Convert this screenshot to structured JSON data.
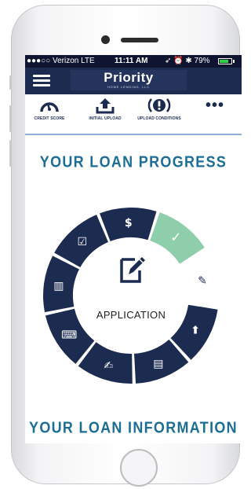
{
  "status_bar": {
    "carrier": "●●●○○ Verizon  LTE",
    "time": "11:11 AM",
    "indicators": "➶ ⏰ ✱ 79%",
    "battery_level": 0.79
  },
  "header": {
    "brand_name": "Priority",
    "brand_tagline": "HOME LENDING, LLC",
    "menu_icon": "hamburger-icon"
  },
  "toolbar": {
    "items": [
      {
        "label": "CREDIT SCORE",
        "icon": "gauge-icon"
      },
      {
        "label": "INITIAL UPLOAD",
        "icon": "upload-icon"
      },
      {
        "label": "UPLOAD CONDITIONS",
        "icon": "alert-icon"
      },
      {
        "label": "",
        "icon": "more-icon",
        "text": "•••"
      }
    ]
  },
  "progress": {
    "title": "YOUR LOAN PROGRESS",
    "current_step": "APPLICATION",
    "current_icon": "edit-document-icon",
    "segments": [
      {
        "icon": "dollar-icon",
        "glyph": "$",
        "state": "pending"
      },
      {
        "icon": "check-icon",
        "glyph": "✓",
        "state": "complete"
      },
      {
        "icon": "edit-icon",
        "glyph": "✎",
        "state": "current"
      },
      {
        "icon": "upload-arrow-icon",
        "glyph": "⬆",
        "state": "pending"
      },
      {
        "icon": "document-icon",
        "glyph": "▤",
        "state": "pending"
      },
      {
        "icon": "signed-document-icon",
        "glyph": "✍",
        "state": "pending"
      },
      {
        "icon": "keyboard-icon",
        "glyph": "⌨",
        "state": "pending"
      },
      {
        "icon": "notebook-icon",
        "glyph": "▥",
        "state": "pending"
      },
      {
        "icon": "checklist-icon",
        "glyph": "☑",
        "state": "pending"
      }
    ]
  },
  "info": {
    "title": "YOUR LOAN INFORMATION"
  },
  "colors": {
    "navy": "#1c2b50",
    "ring_pending": "#1c2b50",
    "ring_complete": "#8fceaa",
    "heading": "#1d6e96",
    "status_bar": "#0f1530"
  }
}
